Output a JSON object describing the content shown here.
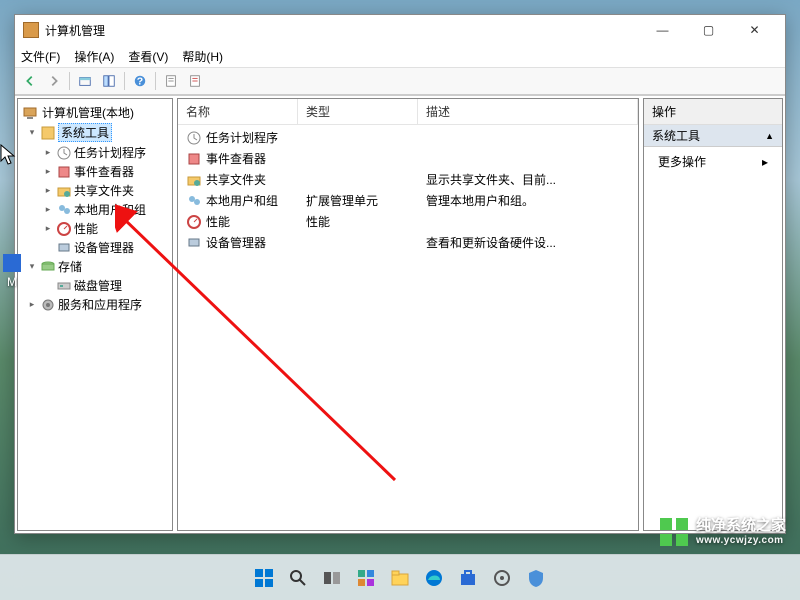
{
  "window": {
    "title": "计算机管理",
    "menus": [
      "文件(F)",
      "操作(A)",
      "查看(V)",
      "帮助(H)"
    ]
  },
  "tree": {
    "root": "计算机管理(本地)",
    "groups": [
      {
        "label": "系统工具",
        "expanded": true,
        "selected": true,
        "children": [
          {
            "label": "任务计划程序",
            "hasChildren": true
          },
          {
            "label": "事件查看器",
            "hasChildren": true
          },
          {
            "label": "共享文件夹",
            "hasChildren": true
          },
          {
            "label": "本地用户和组",
            "hasChildren": true
          },
          {
            "label": "性能",
            "hasChildren": true
          },
          {
            "label": "设备管理器",
            "hasChildren": false
          }
        ]
      },
      {
        "label": "存储",
        "expanded": true,
        "children": [
          {
            "label": "磁盘管理",
            "hasChildren": false
          }
        ]
      },
      {
        "label": "服务和应用程序",
        "expanded": false,
        "hasChildren": true
      }
    ]
  },
  "list": {
    "columns": {
      "name": "名称",
      "type": "类型",
      "desc": "描述"
    },
    "rows": [
      {
        "name": "任务计划程序",
        "type": "",
        "desc": ""
      },
      {
        "name": "事件查看器",
        "type": "",
        "desc": ""
      },
      {
        "name": "共享文件夹",
        "type": "",
        "desc": "显示共享文件夹、目前..."
      },
      {
        "name": "本地用户和组",
        "type": "扩展管理单元",
        "desc": "管理本地用户和组。"
      },
      {
        "name": "性能",
        "type": "性能",
        "desc": ""
      },
      {
        "name": "设备管理器",
        "type": "",
        "desc": "查看和更新设备硬件设..."
      }
    ]
  },
  "actions": {
    "header": "操作",
    "group": "系统工具",
    "more": "更多操作"
  },
  "watermark": {
    "brand": "纯净系统之家",
    "url": "www.ycwjzy.com"
  },
  "desktop": {
    "iconLabel": "M"
  }
}
